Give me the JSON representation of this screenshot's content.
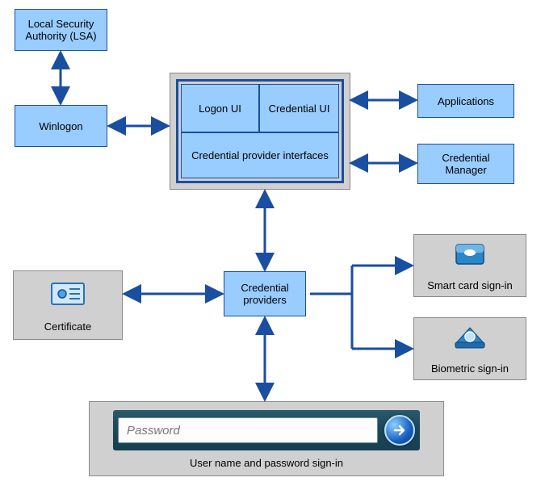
{
  "nodes": {
    "lsa": "Local Security Authority (LSA)",
    "winlogon": "Winlogon",
    "logon_ui": "Logon UI",
    "credential_ui": "Credential UI",
    "cred_prov_interfaces": "Credential provider interfaces",
    "applications": "Applications",
    "credential_manager": "Credential Manager",
    "credential_providers": "Credential providers",
    "certificate": "Certificate",
    "smart_card": "Smart card sign-in",
    "biometric": "Biometric sign-in",
    "user_pw_signin": "User name and password sign-in"
  },
  "password_field": {
    "placeholder": "Password"
  },
  "icons": {
    "certificate": "certificate-icon",
    "smart_card": "smart-card-icon",
    "biometric": "biometric-icon",
    "go_arrow": "arrow-right-icon"
  }
}
